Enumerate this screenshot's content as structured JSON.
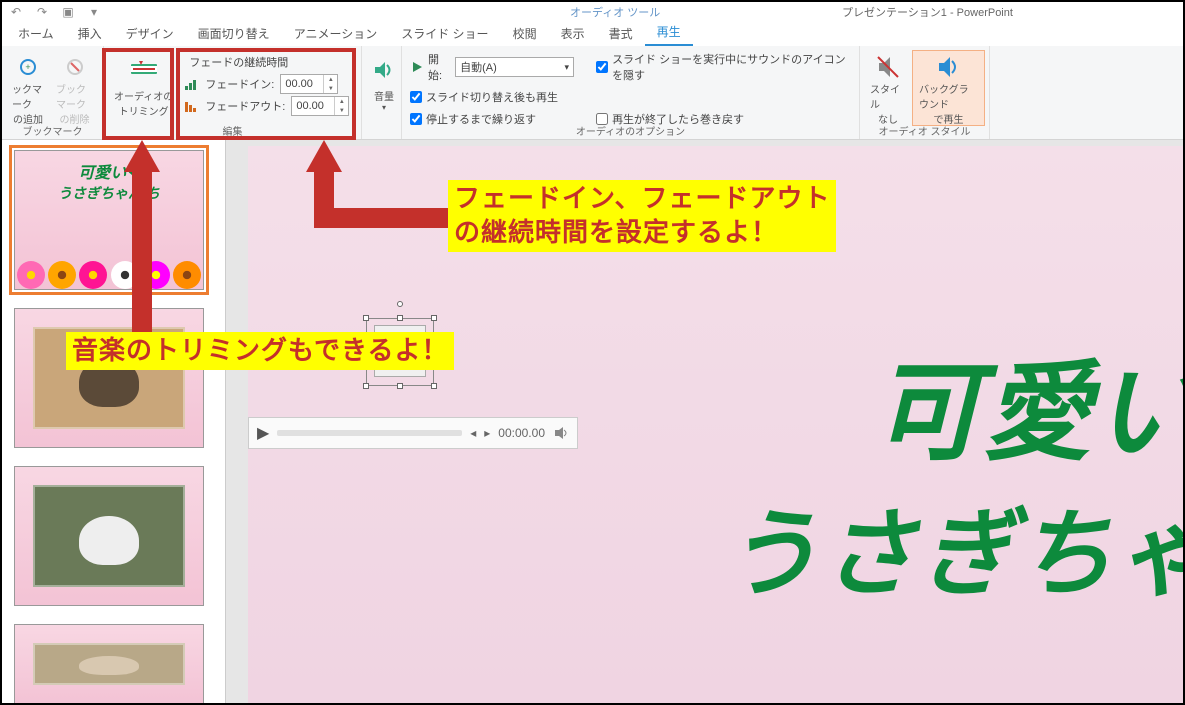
{
  "app": {
    "title": "プレゼンテーション1 - PowerPoint",
    "tool_tab": "オーディオ ツール"
  },
  "tabs": {
    "home": "ホーム",
    "insert": "挿入",
    "design": "デザイン",
    "transitions": "画面切り替え",
    "animations": "アニメーション",
    "slideshow": "スライド ショー",
    "review": "校閲",
    "view": "表示",
    "format": "書式",
    "playback": "再生"
  },
  "ribbon": {
    "bookmark": {
      "add": "ックマーク",
      "add2": "の追加",
      "remove": "ブックマーク",
      "remove2": "の削除",
      "group": "ブックマーク"
    },
    "trim": {
      "label1": "オーディオの",
      "label2": "トリミング"
    },
    "edit": {
      "group": "編集",
      "fade_header": "フェードの継続時間",
      "fade_in_label": "フェードイン:",
      "fade_in_value": "00.00",
      "fade_out_label": "フェードアウト:",
      "fade_out_value": "00.00"
    },
    "volume": {
      "label": "音量"
    },
    "options": {
      "group": "オーディオのオプション",
      "start_label": "開始:",
      "start_value": "自動(A)",
      "hide_icon": "スライド ショーを実行中にサウンドのアイコンを隠す",
      "across_slides": "スライド切り替え後も再生",
      "loop": "停止するまで繰り返す",
      "rewind": "再生が終了したら巻き戻す"
    },
    "style": {
      "group": "オーディオ スタイル",
      "no_style1": "スタイル",
      "no_style2": "なし",
      "bg_play1": "バックグラウンド",
      "bg_play2": "で再生"
    }
  },
  "annotations": {
    "a1_line1": "フェードイン、フェードアウト",
    "a1_line2": "の継続時間を設定するよ！",
    "a2": "音楽のトリミングもできるよ！"
  },
  "slide": {
    "line1": "可愛い",
    "line2": "うさぎちゃ"
  },
  "thumbs": {
    "t1_line1": "可愛い❤",
    "t1_line2": "うさぎちゃん  ち"
  },
  "player": {
    "time": "00:00.00"
  }
}
